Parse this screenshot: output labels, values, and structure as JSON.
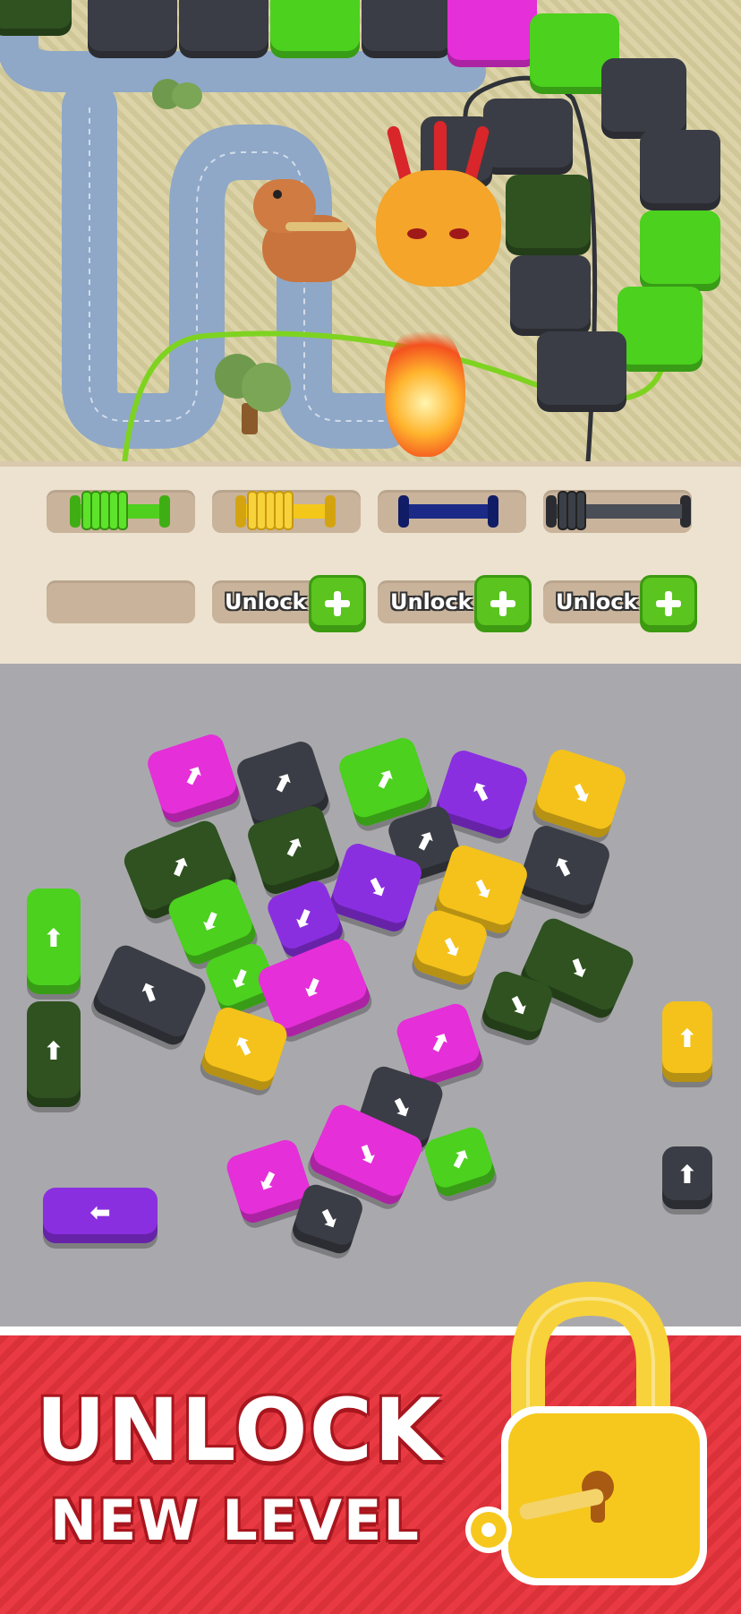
{
  "slots": [
    {
      "type": "spool",
      "color": "#4fd01f",
      "label": ""
    },
    {
      "type": "spool",
      "color": "#f4c81a",
      "label": ""
    },
    {
      "type": "spool",
      "color": "#1b2a86",
      "label": ""
    },
    {
      "type": "spool",
      "color": "#3b3f47",
      "label": ""
    }
  ],
  "locked_slots": [
    {
      "label": "Unlock",
      "button_label": "+"
    },
    {
      "label": "Unlock",
      "button_label": "+"
    },
    {
      "label": "Unlock",
      "button_label": "+"
    }
  ],
  "promo": {
    "line1": "UNLOCK",
    "line2": "NEW LEVEL"
  },
  "colors": {
    "green": "#4bd11e",
    "dark_green": "#2f5220",
    "magenta": "#e52fd8",
    "purple": "#8a2fe0",
    "yellow": "#f4c21a",
    "charcoal": "#3a3d45",
    "blue": "#1b2a86",
    "red": "#e8343d"
  }
}
